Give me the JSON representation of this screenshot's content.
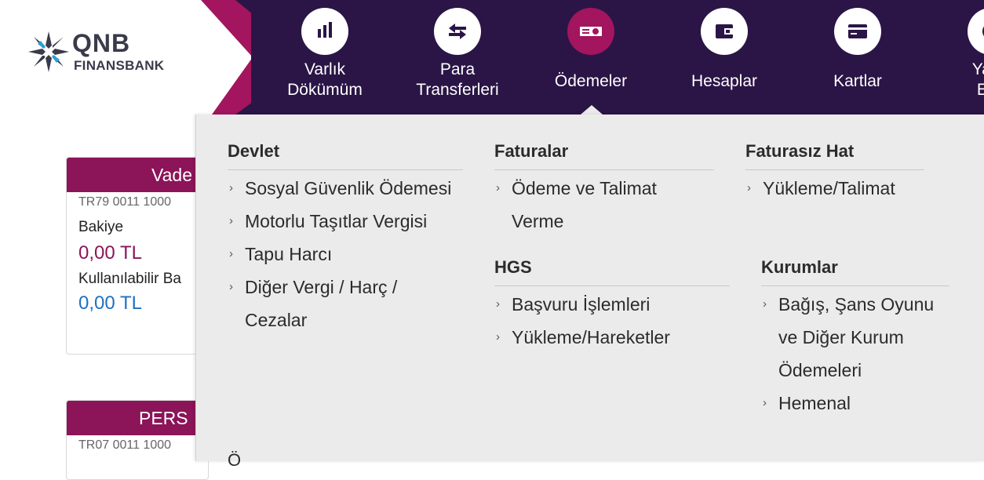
{
  "brand": {
    "line1": "QNB",
    "line2": "FINANSBANK",
    "colors": {
      "nav_bg": "#2a1546",
      "accent": "#a3155e",
      "card_head": "#8c1458",
      "amount_purple": "#8c1458",
      "amount_blue": "#1f70c1",
      "menu_bg": "#ebebeb"
    }
  },
  "nav": [
    {
      "label_1": "Varlık",
      "label_2": "Dökümüm",
      "icon": "bar-chart-icon"
    },
    {
      "label_1": "Para",
      "label_2": "Transferleri",
      "icon": "transfer-arrows-icon"
    },
    {
      "label_1": "Ödemeler",
      "label_2": "",
      "icon": "bill-icon",
      "active": true
    },
    {
      "label_1": "Hesaplar",
      "label_2": "",
      "icon": "wallet-icon"
    },
    {
      "label_1": "Kartlar",
      "label_2": "",
      "icon": "card-icon"
    },
    {
      "label_1": "Yatırı",
      "label_2": "Emi",
      "icon": "investment-icon"
    }
  ],
  "cards": [
    {
      "title": "Vade",
      "account": "TR79 0011 1000",
      "balance_label": "Bakiye",
      "balance": "0,00 TL",
      "available_label": "Kullanılabilir Ba",
      "available": "0,00 TL"
    },
    {
      "title": "PERS",
      "account": "TR07 0011 1000"
    }
  ],
  "menu": {
    "devlet": {
      "title": "Devlet",
      "items": [
        "Sosyal Güvenlik Ödemesi",
        "Motorlu Taşıtlar Vergisi",
        "Tapu Harcı",
        "Diğer Vergi / Harç /",
        "Cezalar"
      ]
    },
    "faturalar": {
      "title": "Faturalar",
      "items": [
        "Ödeme ve Talimat",
        "Verme"
      ]
    },
    "hgs": {
      "title": "HGS",
      "items": [
        "Başvuru İşlemleri",
        "Yükleme/Hareketler"
      ]
    },
    "faturasiz_hat": {
      "title": "Faturasız Hat",
      "items": [
        "Yükleme/Talimat"
      ]
    },
    "kurumlar": {
      "title": "Kurumlar",
      "items": [
        "Bağış, Şans Oyunu",
        "ve Diğer Kurum",
        "Ödemeleri",
        "Hemenal"
      ]
    },
    "partial_heading": "Ö"
  }
}
